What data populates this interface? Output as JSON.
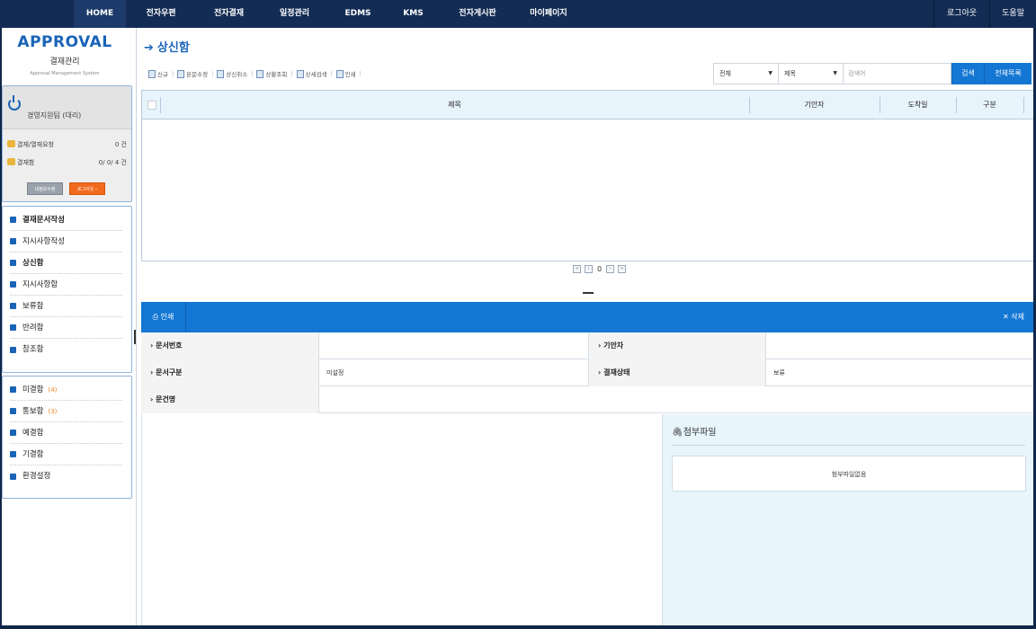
{
  "nav": {
    "items": [
      "HOME",
      "전자우편",
      "전자결재",
      "일정관리",
      "EDMS",
      "KMS",
      "전자게시판",
      "마이페이지"
    ],
    "right": [
      "로그아웃",
      "도움말"
    ]
  },
  "logo": {
    "title": "APPROVAL",
    "subtitle": "결재관리",
    "tagline": "Approval Management System"
  },
  "user": {
    "name": "경영지원팀 (대리)",
    "rows": [
      {
        "label": "결재/열재요청",
        "value": "0 건"
      },
      {
        "label": "결재함",
        "value": "0/ 0/ 4 건"
      }
    ],
    "btn_info": "내정보수정",
    "btn_logout": "로그아웃 ›"
  },
  "menu1": [
    {
      "label": "결재문서작성",
      "bold": true
    },
    {
      "label": "지시사항작성",
      "bold": false
    },
    {
      "label": "상신함",
      "bold": true
    },
    {
      "label": "지시사항함",
      "bold": false
    },
    {
      "label": "보류함",
      "bold": false
    },
    {
      "label": "반려함",
      "bold": false
    },
    {
      "label": "참조함",
      "bold": false
    }
  ],
  "menu2": [
    {
      "label": "미결함",
      "count": "(4)"
    },
    {
      "label": "통보함",
      "count": "(3)"
    },
    {
      "label": "예결함",
      "count": ""
    },
    {
      "label": "기결함",
      "count": ""
    },
    {
      "label": "환경설정",
      "count": ""
    }
  ],
  "page": {
    "title": "상신함"
  },
  "toolbar": [
    "신규",
    "본문수정",
    "상신취소",
    "상황조회",
    "상세검색",
    "인쇄"
  ],
  "search": {
    "scope": "전체",
    "field": "제목",
    "placeholder": "검색어",
    "search_btn": "검색",
    "list_btn": "전체목록"
  },
  "grid": {
    "columns": [
      "제목",
      "기안자",
      "도착일",
      "구분"
    ]
  },
  "pager": {
    "page": "0"
  },
  "detail": {
    "print": "인쇄",
    "delete": "삭제",
    "fields": {
      "doc_no_label": "› 문서번호",
      "drafter_label": "› 기안자",
      "doc_type_label": "› 문서구분",
      "doc_type_value": "미설정",
      "status_label": "› 결재상태",
      "status_value": "보류",
      "file_label": "› 문건명"
    }
  },
  "attach": {
    "title": "첨부파일",
    "empty": "첨부파일없음"
  }
}
